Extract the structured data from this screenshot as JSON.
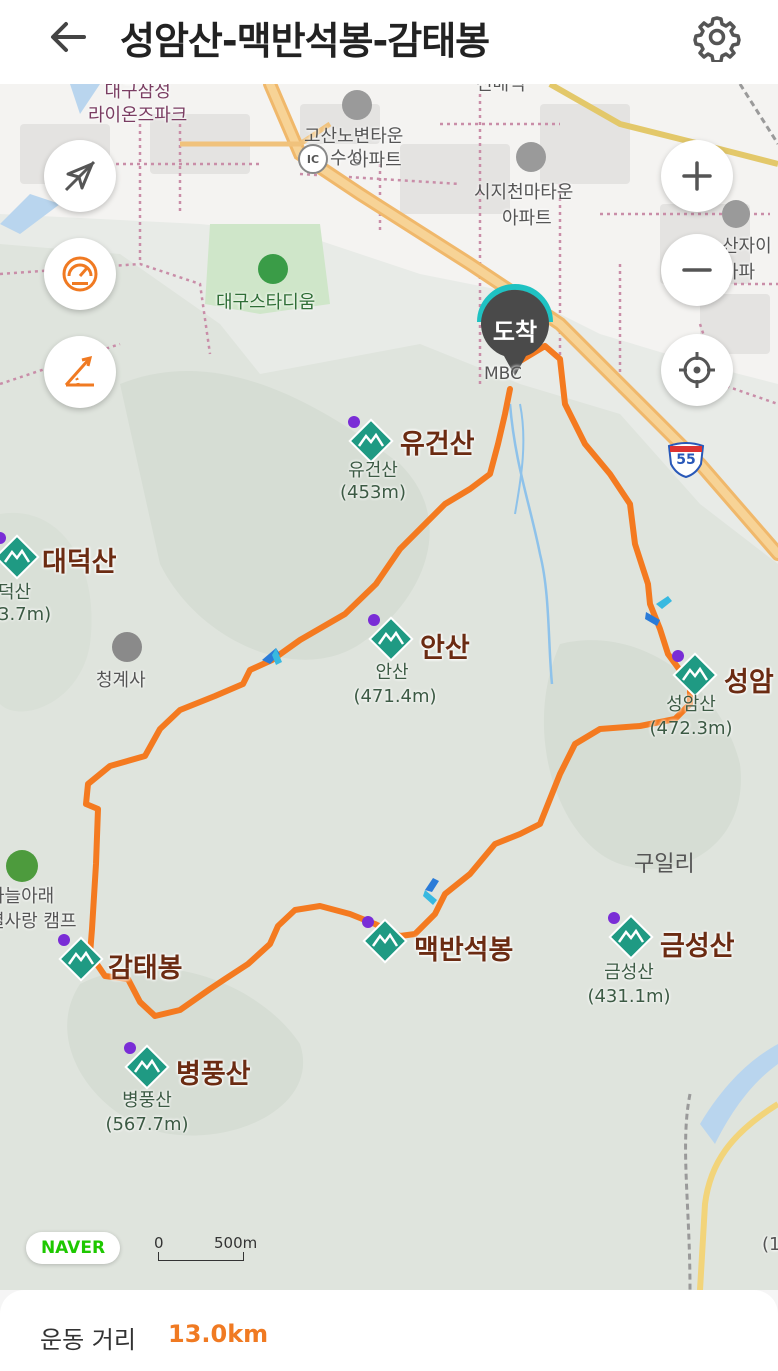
{
  "header": {
    "title": "성암산-맥반석봉-감태봉"
  },
  "map": {
    "arrival_pin_label": "도착",
    "peaks": [
      {
        "name": "유건산",
        "sub_name": "유건산",
        "elevation": "(453m)"
      },
      {
        "name": "대덕산",
        "sub_name": "덕산",
        "elevation": "3.7m)"
      },
      {
        "name": "안산",
        "sub_name": "안산",
        "elevation": "(471.4m)"
      },
      {
        "name": "성암",
        "sub_name": "성암산",
        "elevation": "(472.3m)"
      },
      {
        "name": "감태봉",
        "sub_name": "",
        "elevation": ""
      },
      {
        "name": "맥반석봉",
        "sub_name": "",
        "elevation": ""
      },
      {
        "name": "금성산",
        "sub_name": "금성산",
        "elevation": "(431.1m)"
      },
      {
        "name": "병풍산",
        "sub_name": "병풍산",
        "elevation": "(567.7m)"
      }
    ],
    "pois": {
      "lions_park": "대구삼성\n라이온즈파크",
      "gosan_town": "고산노변타운",
      "suseong": "수성",
      "apt_suffix": "아파트",
      "ic": "IC",
      "sijicheon": "시지천마타운",
      "sijicheon_apt": "아파트",
      "stadium": "대구스타디움",
      "mbc": "MBC",
      "cheonggyesa": "청계사",
      "campsite": "하늘아래\n별사랑 캠프",
      "guilri": "구일리",
      "highway_no": "55",
      "top_road": "신매역",
      "right_apt": "산자이\n아파",
      "right_edge": "(1"
    },
    "scale": {
      "zero": "0",
      "distance": "500m"
    },
    "naver_logo": "NAVER",
    "colors": {
      "route": "#f47a20",
      "peak_icon": "#1f9a83",
      "peak_name": "#6b2b12",
      "pin": "#4a4a4a",
      "pin_ring": "#1fc2c2"
    }
  },
  "controls": {
    "left": [
      "compass-off-icon",
      "speedometer-icon",
      "angle-icon"
    ],
    "right": [
      "zoom-in-icon",
      "zoom-out-icon",
      "locate-icon"
    ]
  },
  "footer": {
    "label": "운동 거리",
    "value": "13.0km"
  }
}
